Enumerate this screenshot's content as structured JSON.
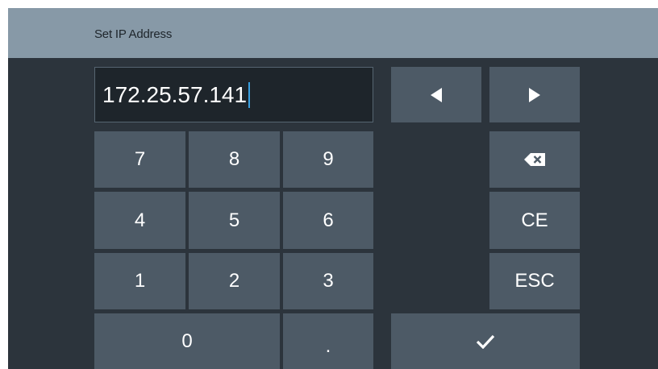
{
  "title": "Set IP Address",
  "ip_value": "172.25.57.141",
  "keys": {
    "k7": "7",
    "k8": "8",
    "k9": "9",
    "k4": "4",
    "k5": "5",
    "k6": "6",
    "k1": "1",
    "k2": "2",
    "k3": "3",
    "k0": "0",
    "dot": ".",
    "ce": "CE",
    "esc": "ESC"
  },
  "icons": {
    "left": "arrow-left-icon",
    "right": "arrow-right-icon",
    "backspace": "backspace-icon",
    "confirm": "checkmark-icon"
  },
  "colors": {
    "titlebar": "#8799a7",
    "background": "#2c343c",
    "key": "#4d5a66",
    "field": "#1e252b",
    "caret": "#3aa0e0"
  }
}
